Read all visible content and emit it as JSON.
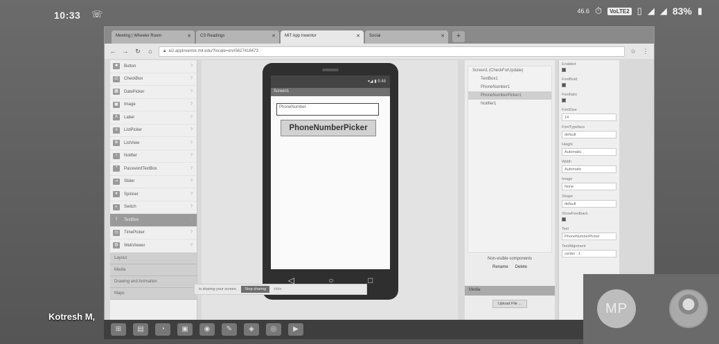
{
  "status_bar": {
    "time": "10:33",
    "left_icons": "☏",
    "net_speed": "46.6",
    "volte_badge": "VoLTE2",
    "battery": "83%"
  },
  "browser": {
    "tabs": [
      {
        "label": "Meeting | Wheeler Room"
      },
      {
        "label": "CS Readings"
      },
      {
        "label": "MIT App Inventor"
      },
      {
        "label": "Social"
      }
    ],
    "new_tab_label": "+",
    "url": "ai2.appinventor.mit.edu/?locale=en#5627418473"
  },
  "palette": {
    "items": [
      {
        "label": "Button",
        "icon": "■"
      },
      {
        "label": "CheckBox",
        "icon": "☑"
      },
      {
        "label": "DatePicker",
        "icon": "▦"
      },
      {
        "label": "Image",
        "icon": "▣"
      },
      {
        "label": "Label",
        "icon": "A"
      },
      {
        "label": "ListPicker",
        "icon": "≡"
      },
      {
        "label": "ListView",
        "icon": "≣"
      },
      {
        "label": "Notifier",
        "icon": "!"
      },
      {
        "label": "PasswordTextBox",
        "icon": "*"
      },
      {
        "label": "Slider",
        "icon": "⊸"
      },
      {
        "label": "Spinner",
        "icon": "▾"
      },
      {
        "label": "Switch",
        "icon": "◐"
      },
      {
        "label": "TextBox",
        "icon": "I"
      },
      {
        "label": "TimePicker",
        "icon": "◷"
      },
      {
        "label": "WebViewer",
        "icon": "◍"
      }
    ],
    "sections": [
      "Layout",
      "Media",
      "Drawing and Animation",
      "Maps"
    ]
  },
  "viewer": {
    "phone_status": "▾◢ ▮ 9:48",
    "screen_title": "Screen1",
    "textbox_hint": "PhoneNumber",
    "button_label": "PhoneNumberPicker",
    "nav_back": "◁",
    "nav_home": "○",
    "nav_recent": "□"
  },
  "components": {
    "tree": [
      {
        "label": "Screen1 (CheckForUpdate)",
        "indent": false
      },
      {
        "label": "TextBox1",
        "indent": true
      },
      {
        "label": "PhoneNumber1",
        "indent": true
      },
      {
        "label": "PhoneNumberPicker1",
        "indent": true
      },
      {
        "label": "Notifier1",
        "indent": true
      }
    ],
    "action_hint": "Non-visible components",
    "rename_label": "Rename",
    "delete_label": "Delete",
    "media_header": "Media",
    "upload_label": "Upload File ..."
  },
  "properties": {
    "items": [
      {
        "label": "Enabled",
        "type": "check"
      },
      {
        "label": "FontBold",
        "type": "check"
      },
      {
        "label": "FontItalic",
        "type": "check"
      },
      {
        "label": "FontSize",
        "type": "input",
        "value": "14"
      },
      {
        "label": "FontTypeface",
        "type": "input",
        "value": "default"
      },
      {
        "label": "Height",
        "type": "input",
        "value": "Automatic"
      },
      {
        "label": "Width",
        "type": "input",
        "value": "Automatic"
      },
      {
        "label": "Image",
        "type": "input",
        "value": "None"
      },
      {
        "label": "Shape",
        "type": "input",
        "value": "default"
      },
      {
        "label": "ShowFeedback",
        "type": "check"
      },
      {
        "label": "Text",
        "type": "input",
        "value": "PhoneNumberPicker"
      },
      {
        "label": "TextAlignment",
        "type": "input",
        "value": "center : 1"
      }
    ]
  },
  "share_bar": {
    "message": "is sharing your screen.",
    "stop_label": "Stop sharing",
    "hide_label": "Hide"
  },
  "taskbar": {
    "icons": [
      "⊞",
      "▤",
      "◔",
      "▣",
      "◉",
      "✎",
      "◈",
      "◎",
      "▶"
    ]
  },
  "meeting": {
    "caller": "Kotresh M,",
    "participant_initials": "MP"
  }
}
